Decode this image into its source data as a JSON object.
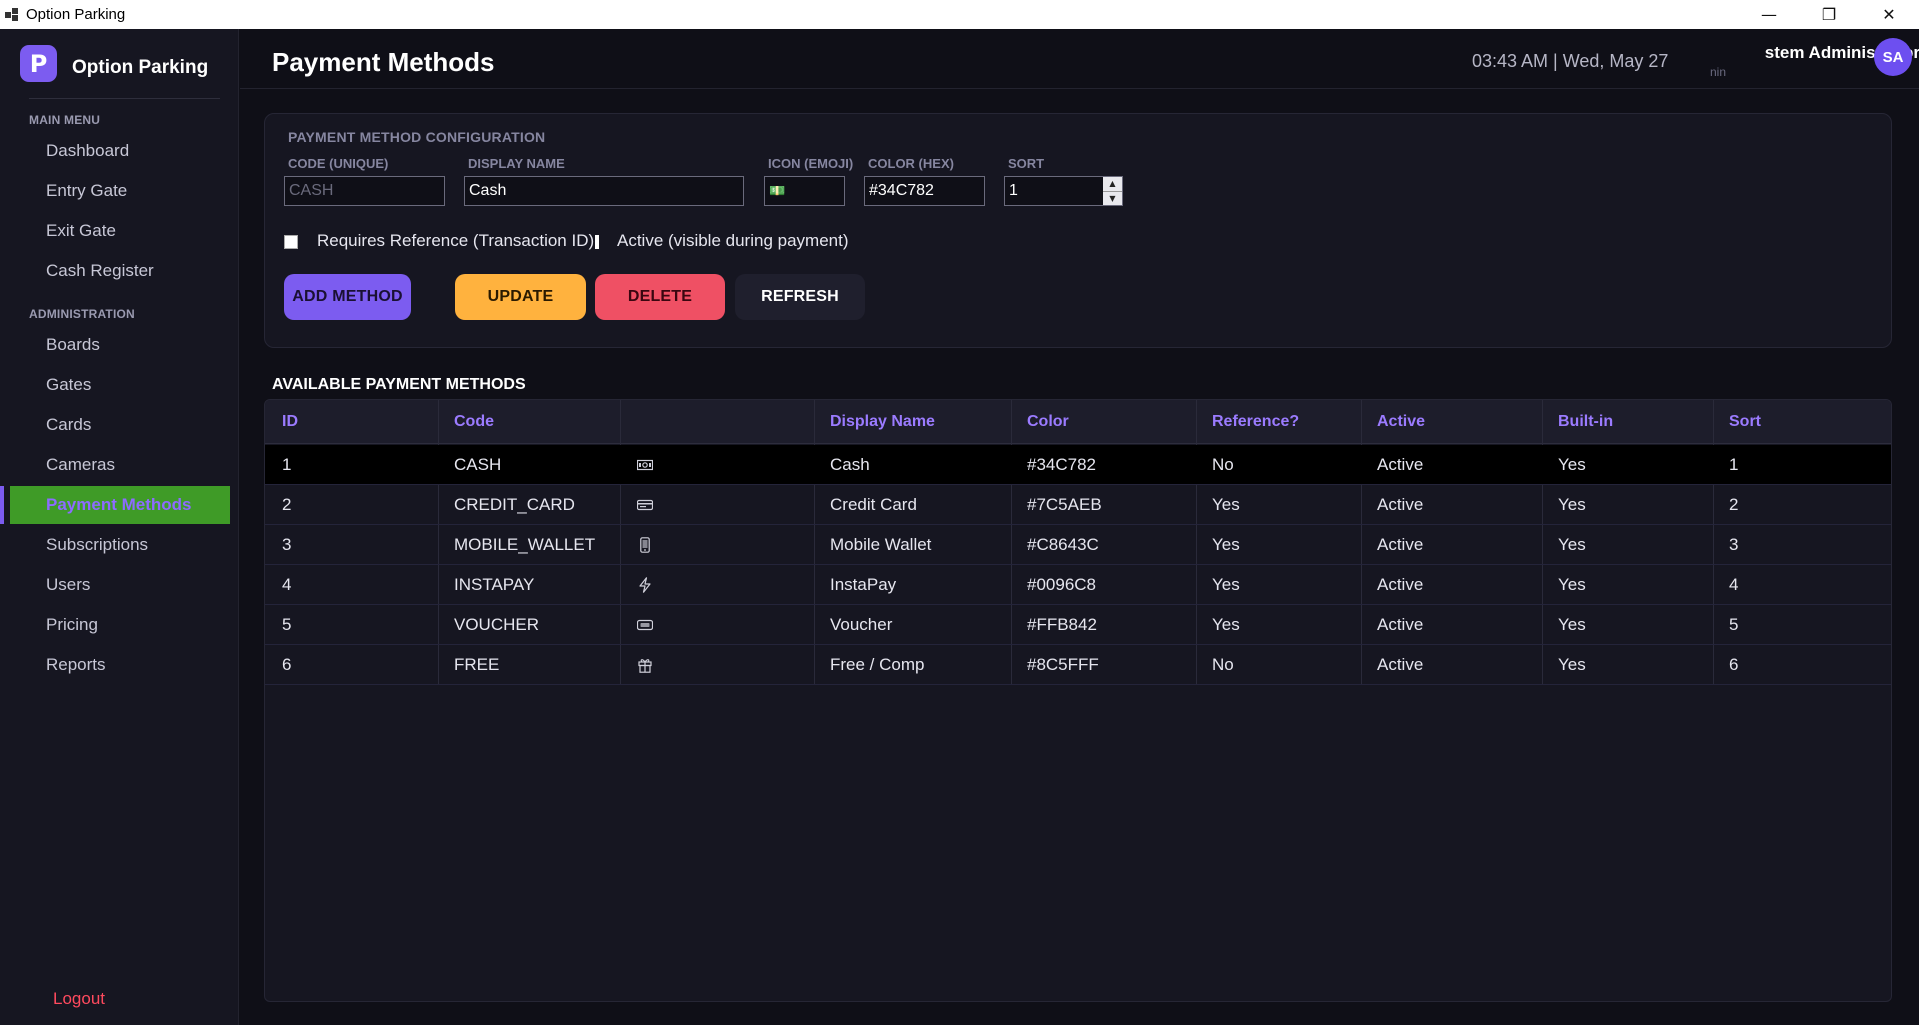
{
  "window": {
    "title": "Option Parking",
    "minimize": "—",
    "maximize": "❐",
    "close": "✕"
  },
  "sidebar": {
    "logo_letter": "P",
    "brand": "Option Parking",
    "sections": [
      {
        "label": "MAIN MENU"
      },
      {
        "label": "ADMINISTRATION"
      }
    ],
    "items": [
      {
        "label": "Dashboard"
      },
      {
        "label": "Entry Gate"
      },
      {
        "label": "Exit Gate"
      },
      {
        "label": "Cash Register"
      },
      {
        "label": "Boards"
      },
      {
        "label": "Gates"
      },
      {
        "label": "Cards"
      },
      {
        "label": "Cameras"
      },
      {
        "label": "Payment Methods"
      },
      {
        "label": "Subscriptions"
      },
      {
        "label": "Users"
      },
      {
        "label": "Pricing"
      },
      {
        "label": "Reports"
      }
    ],
    "active_item": "Payment Methods",
    "logout": "Logout"
  },
  "header": {
    "title": "Payment Methods",
    "clock": "03:43 AM  |  Wed, May 27",
    "user_name": "stem Administrator",
    "user_role": "nin",
    "avatar_initials": "SA"
  },
  "config": {
    "title": "PAYMENT METHOD CONFIGURATION",
    "code_label": "CODE (UNIQUE)",
    "code_placeholder": "CASH",
    "display_label": "DISPLAY NAME",
    "display_value": "Cash",
    "icon_label": "ICON (EMOJI)",
    "icon_value": "💵",
    "color_label": "COLOR (HEX)",
    "color_value": "#34C782",
    "sort_label": "SORT",
    "sort_value": "1",
    "requires_ref_label": "Requires Reference (Transaction ID)",
    "active_label": "Active (visible during payment)",
    "buttons": {
      "add": "ADD METHOD",
      "update": "UPDATE",
      "delete": "DELETE",
      "refresh": "REFRESH"
    }
  },
  "table": {
    "heading": "AVAILABLE PAYMENT METHODS",
    "columns": [
      "ID",
      "Code",
      "",
      "Display Name",
      "Color",
      "Reference?",
      "Active",
      "Built-in",
      "Sort"
    ],
    "rows": [
      {
        "id": "1",
        "code": "CASH",
        "icon": "cash-icon",
        "name": "Cash",
        "color": "#34C782",
        "ref": "No",
        "active": "Active",
        "builtin": "Yes",
        "sort": "1"
      },
      {
        "id": "2",
        "code": "CREDIT_CARD",
        "icon": "credit-card-icon",
        "name": "Credit Card",
        "color": "#7C5AEB",
        "ref": "Yes",
        "active": "Active",
        "builtin": "Yes",
        "sort": "2"
      },
      {
        "id": "3",
        "code": "MOBILE_WALLET",
        "icon": "mobile-phone-icon",
        "name": "Mobile Wallet",
        "color": "#C8643C",
        "ref": "Yes",
        "active": "Active",
        "builtin": "Yes",
        "sort": "3"
      },
      {
        "id": "4",
        "code": "INSTAPAY",
        "icon": "lightning-icon",
        "name": "InstaPay",
        "color": "#0096C8",
        "ref": "Yes",
        "active": "Active",
        "builtin": "Yes",
        "sort": "4"
      },
      {
        "id": "5",
        "code": "VOUCHER",
        "icon": "ticket-icon",
        "name": "Voucher",
        "color": "#FFB842",
        "ref": "Yes",
        "active": "Active",
        "builtin": "Yes",
        "sort": "5"
      },
      {
        "id": "6",
        "code": "FREE",
        "icon": "gift-icon",
        "name": "Free / Comp",
        "color": "#8C5FFF",
        "ref": "No",
        "active": "Active",
        "builtin": "Yes",
        "sort": "6"
      }
    ]
  },
  "colors": {
    "accent": "#7C5CF0",
    "active_nav": "#3F9B27",
    "update": "#FFB23E",
    "delete": "#EF5064",
    "logout": "#FF4A5E"
  }
}
